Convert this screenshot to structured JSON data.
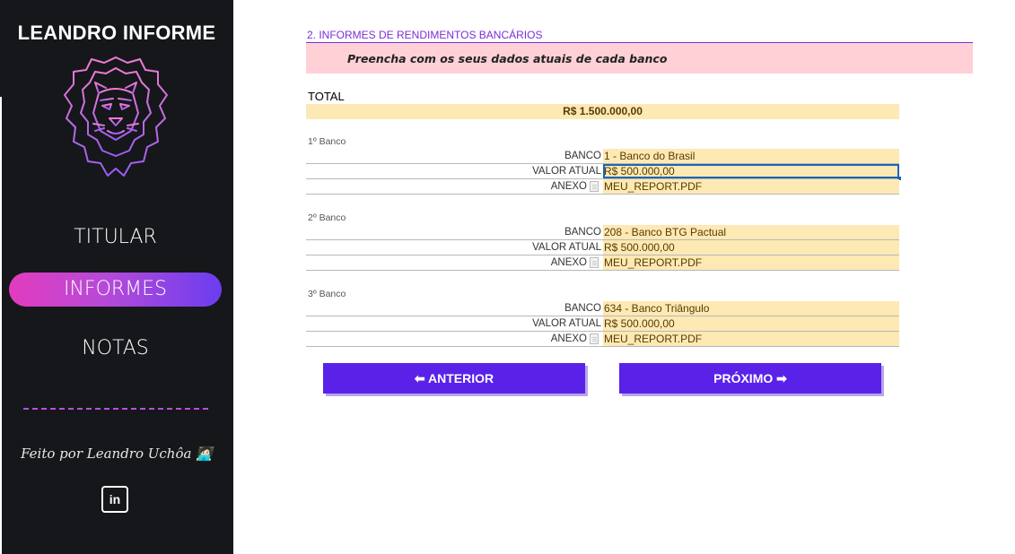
{
  "sidebar": {
    "app_title": "LEANDRO INFORME",
    "nav": {
      "titular": "TITULAR",
      "informes": "INFORMES",
      "notas": "NOTAS"
    },
    "credit": "Feito por Leandro Uchôa 🧑🏻‍💻",
    "linkedin_icon_text": "in"
  },
  "main": {
    "section_title": "2. INFORMES DE RENDIMENTOS BANCÁRIOS",
    "banner_text": "Preencha com os seus dados atuais de cada banco",
    "total_label": "TOTAL",
    "total_value": "R$ 1.500.000,00",
    "banks": [
      {
        "label": "1º Banco",
        "banco_label": "BANCO",
        "banco_value": "1 - Banco do Brasil",
        "valor_label": "VALOR ATUAL",
        "valor_value": "R$ 500.000,00",
        "anexo_label": "ANEXO",
        "anexo_value": "MEU_REPORT.PDF"
      },
      {
        "label": "2º Banco",
        "banco_label": "BANCO",
        "banco_value": "208 - Banco BTG Pactual",
        "valor_label": "VALOR ATUAL",
        "valor_value": "R$ 500.000,00",
        "anexo_label": "ANEXO",
        "anexo_value": "MEU_REPORT.PDF"
      },
      {
        "label": "3º Banco",
        "banco_label": "BANCO",
        "banco_value": "634 - Banco Triângulo",
        "valor_label": "VALOR ATUAL",
        "valor_value": "R$ 500.000,00",
        "anexo_label": "ANEXO",
        "anexo_value": "MEU_REPORT.PDF"
      }
    ],
    "buttons": {
      "prev": "⬅ ANTERIOR",
      "next": "PRÓXIMO ➡"
    }
  },
  "colors": {
    "sidebar_bg": "#15171b",
    "accent_purple": "#5a22e8",
    "accent_pink": "#e23bbd",
    "input_fill": "#fde9b4",
    "banner_fill": "#ffd0d5"
  }
}
